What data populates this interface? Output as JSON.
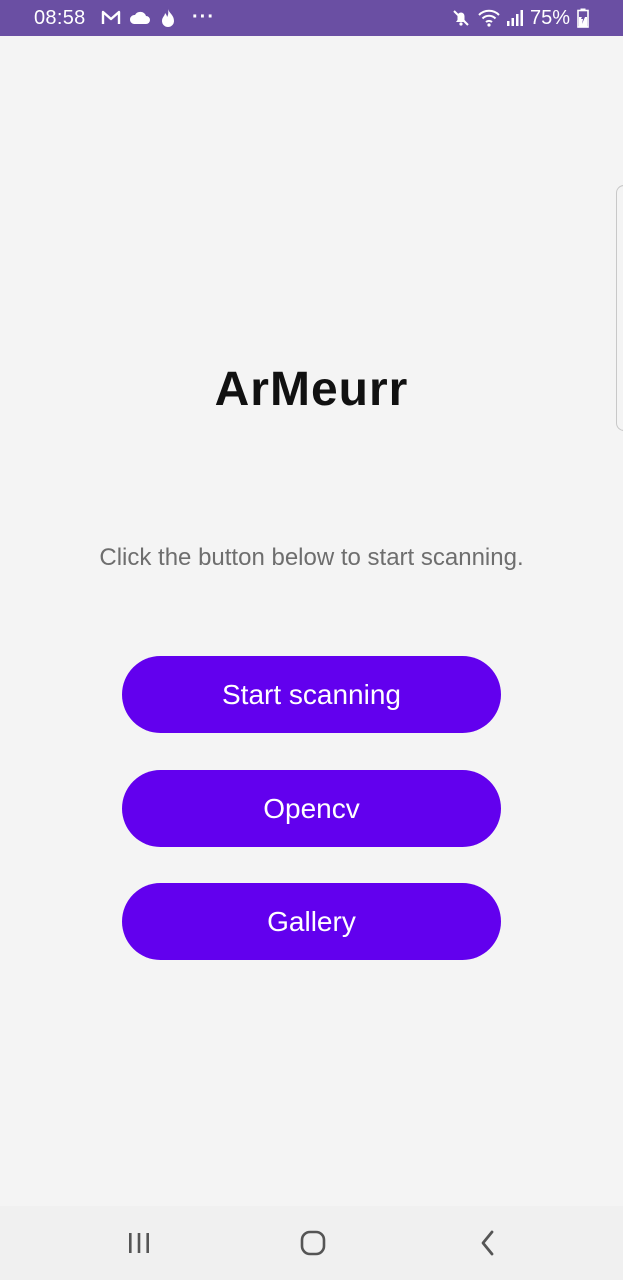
{
  "status_bar": {
    "time": "08:58",
    "more": "···",
    "battery_percent": "75%",
    "icons": [
      "gmail-icon",
      "cloud-icon",
      "flame-icon",
      "mute-icon",
      "wifi-icon",
      "signal-icon",
      "battery-charging-icon"
    ]
  },
  "main": {
    "title": "ArMeurr",
    "subtitle": "Click the button below to start scanning.",
    "buttons": [
      {
        "label": "Start scanning"
      },
      {
        "label": "Opencv"
      },
      {
        "label": "Gallery"
      }
    ]
  },
  "nav_bar": {
    "icons": [
      "recent-apps-icon",
      "home-icon",
      "back-icon"
    ]
  },
  "colors": {
    "status_bar": "#6a4fa3",
    "background": "#f4f4f4",
    "button": "#6200ee",
    "button_text": "#ffffff",
    "title": "#111111",
    "subtitle": "#6e6e6e"
  }
}
